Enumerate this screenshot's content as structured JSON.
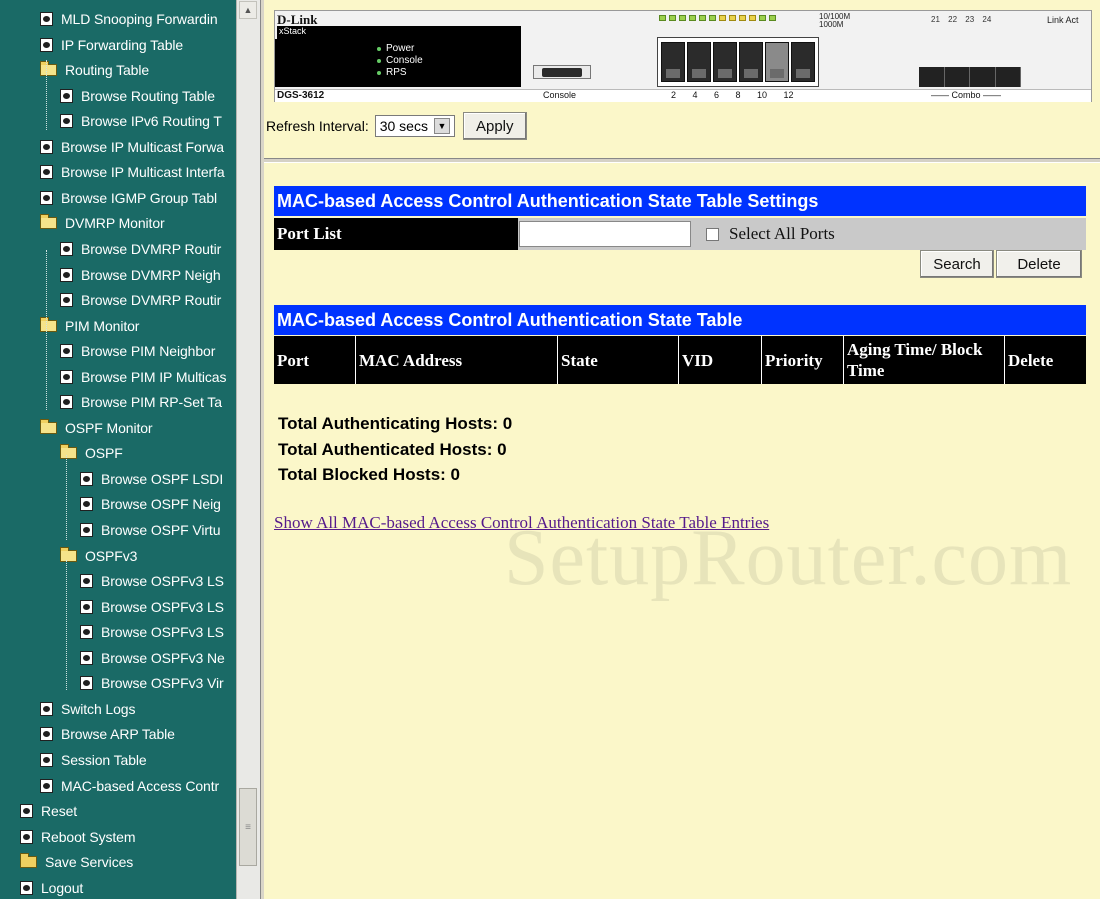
{
  "sidebar": {
    "items": [
      {
        "label": "MLD Snooping Forwardin",
        "icon": "doc",
        "indent": 1
      },
      {
        "label": "IP Forwarding Table",
        "icon": "doc",
        "indent": 1
      },
      {
        "label": "Routing Table",
        "icon": "folder-open",
        "indent": 1
      },
      {
        "label": "Browse Routing Table",
        "icon": "doc",
        "indent": 2
      },
      {
        "label": "Browse IPv6 Routing T",
        "icon": "doc",
        "indent": 2
      },
      {
        "label": "Browse IP Multicast Forwa",
        "icon": "doc",
        "indent": 1
      },
      {
        "label": "Browse IP Multicast Interfa",
        "icon": "doc",
        "indent": 1
      },
      {
        "label": "Browse IGMP Group Tabl",
        "icon": "doc",
        "indent": 1
      },
      {
        "label": "DVMRP Monitor",
        "icon": "folder-open",
        "indent": 1
      },
      {
        "label": "Browse DVMRP Routir",
        "icon": "doc",
        "indent": 2
      },
      {
        "label": "Browse DVMRP Neigh",
        "icon": "doc",
        "indent": 2
      },
      {
        "label": "Browse DVMRP Routir",
        "icon": "doc",
        "indent": 2
      },
      {
        "label": "PIM Monitor",
        "icon": "folder-open",
        "indent": 1
      },
      {
        "label": "Browse PIM Neighbor",
        "icon": "doc",
        "indent": 2
      },
      {
        "label": "Browse PIM IP Multicas",
        "icon": "doc",
        "indent": 2
      },
      {
        "label": "Browse PIM RP-Set Ta",
        "icon": "doc",
        "indent": 2
      },
      {
        "label": "OSPF Monitor",
        "icon": "folder-open",
        "indent": 1
      },
      {
        "label": "OSPF",
        "icon": "folder-open",
        "indent": 2
      },
      {
        "label": "Browse OSPF LSDI",
        "icon": "doc",
        "indent": 3
      },
      {
        "label": "Browse OSPF Neig",
        "icon": "doc",
        "indent": 3
      },
      {
        "label": "Browse OSPF Virtu",
        "icon": "doc",
        "indent": 3
      },
      {
        "label": "OSPFv3",
        "icon": "folder-open",
        "indent": 2
      },
      {
        "label": "Browse OSPFv3 LS",
        "icon": "doc",
        "indent": 3
      },
      {
        "label": "Browse OSPFv3 LS",
        "icon": "doc",
        "indent": 3
      },
      {
        "label": "Browse OSPFv3 LS",
        "icon": "doc",
        "indent": 3
      },
      {
        "label": "Browse OSPFv3 Ne",
        "icon": "doc",
        "indent": 3
      },
      {
        "label": "Browse OSPFv3 Vir",
        "icon": "doc",
        "indent": 3
      },
      {
        "label": "Switch Logs",
        "icon": "doc",
        "indent": 1
      },
      {
        "label": "Browse ARP Table",
        "icon": "doc",
        "indent": 1
      },
      {
        "label": "Session Table",
        "icon": "doc",
        "indent": 1
      },
      {
        "label": "MAC-based Access Contr",
        "icon": "doc",
        "indent": 1
      },
      {
        "label": "Reset",
        "icon": "doc",
        "indent": 0
      },
      {
        "label": "Reboot System",
        "icon": "doc",
        "indent": 0
      },
      {
        "label": "Save Services",
        "icon": "folder",
        "indent": 0
      },
      {
        "label": "Logout",
        "icon": "doc",
        "indent": 0
      }
    ]
  },
  "device": {
    "brand": "D-Link",
    "series": "xStack",
    "leds": [
      "Power",
      "Console",
      "RPS"
    ],
    "model": "DGS-3612",
    "console_label": "Console",
    "port_numbers": "2 4 6 8 10 12",
    "combo_label": "—— Combo ——",
    "speed_legend_1": "10/100M",
    "speed_legend_2": "1000M",
    "combo_ids": "21 22 23 24",
    "link_legend": "Link Act"
  },
  "refresh": {
    "label": "Refresh Interval:",
    "value": "30 secs",
    "apply_label": "Apply"
  },
  "settings": {
    "title": "MAC-based Access Control Authentication State Table Settings",
    "port_list_label": "Port List",
    "port_list_value": "",
    "select_all_label": "Select All Ports",
    "search_label": "Search",
    "delete_label": "Delete"
  },
  "state_table": {
    "title": "MAC-based Access Control Authentication State Table",
    "columns": [
      "Port",
      "MAC Address",
      "State",
      "VID",
      "Priority",
      "Aging Time/ Block Time",
      "Delete"
    ]
  },
  "totals": {
    "authenticating": "Total Authenticating Hosts:  0",
    "authenticated": "Total Authenticated Hosts:  0",
    "blocked": "Total Blocked Hosts:  0"
  },
  "show_all_link": "Show All MAC-based Access Control Authentication State Table Entries",
  "watermark": "SetupRouter.com",
  "colors": {
    "sidebar_bg": "#1a6a66",
    "page_bg": "#fbf7c9",
    "header_blue": "#0033ff",
    "header_black": "#000000"
  }
}
